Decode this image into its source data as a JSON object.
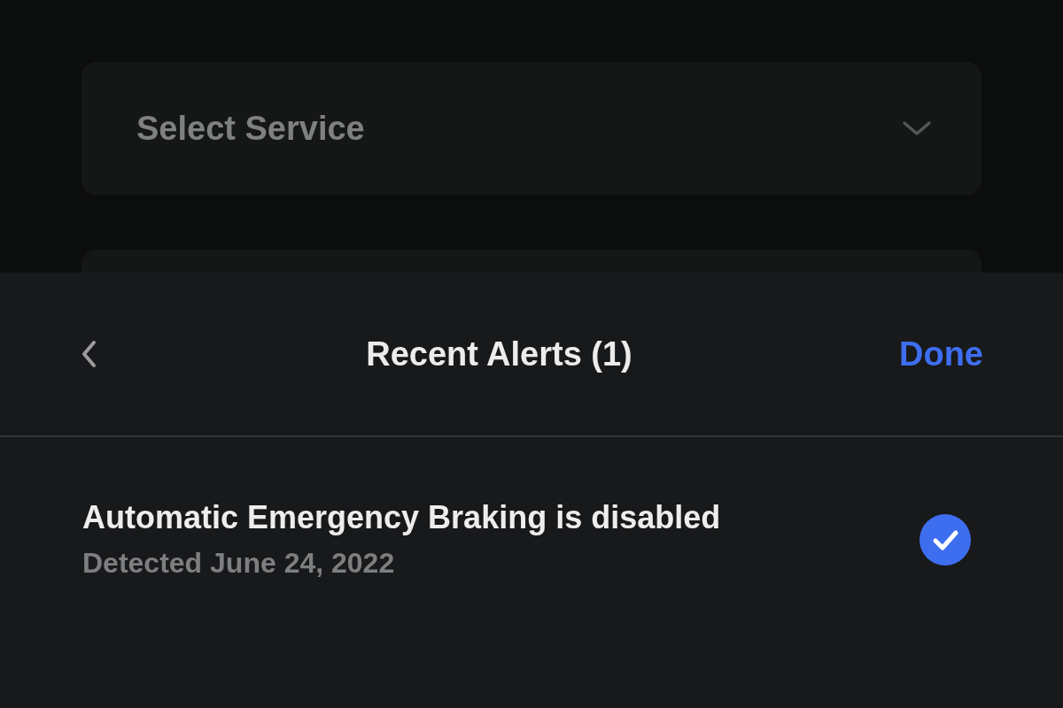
{
  "service_select": {
    "placeholder": "Select Service"
  },
  "alerts_sheet": {
    "title": "Recent Alerts (1)",
    "done_label": "Done",
    "alerts": [
      {
        "title": "Automatic Emergency Braking is disabled",
        "detected": "Detected June 24, 2022",
        "checked": true
      }
    ]
  }
}
